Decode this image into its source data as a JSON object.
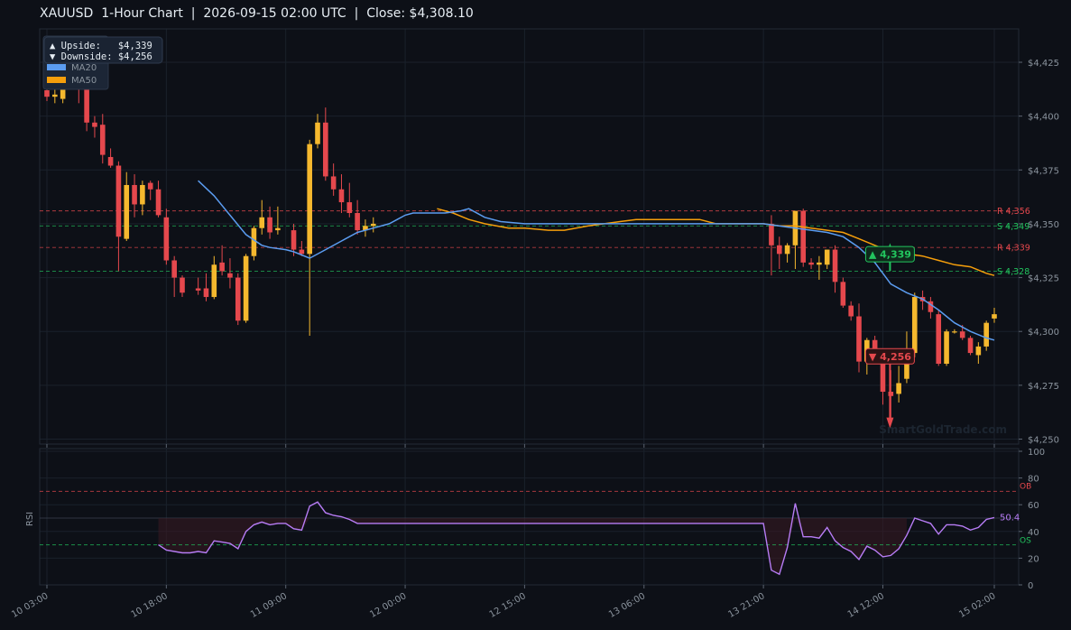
{
  "title": "XAUUSD  1-Hour Chart  |  2026-09-15 02:00 UTC  |  Close: $4,308.10",
  "watermark": "SmartGoldTrade.com",
  "info_box": {
    "upside": "▲ Upside:   $4,339",
    "downside": "▼ Downside: $4,256"
  },
  "colors": {
    "background": "#0d1017",
    "bull": "#f5b82e",
    "bear": "#e5484d",
    "ma20": "#5b9cf0",
    "ma50": "#f59e0b",
    "rsi": "#b77cf5",
    "support": "#22c55e",
    "resistance": "#e5484d"
  },
  "chart_data": [
    {
      "type": "candlestick",
      "title": "XAUUSD  1-Hour Chart  |  2026-09-15 02:00 UTC  |  Close: $4,308.10",
      "ylim": [
        4248,
        4441
      ],
      "y_ticks": [
        "$4,250",
        "$4,275",
        "$4,300",
        "$4,325",
        "$4,350",
        "$4,375",
        "$4,400",
        "$4,425"
      ],
      "y_tick_values": [
        4250,
        4275,
        4300,
        4325,
        4350,
        4375,
        4400,
        4425
      ],
      "x_ticks": [
        "10 03:00",
        "10 18:00",
        "11 09:00",
        "12 00:00",
        "12 15:00",
        "13 06:00",
        "13 21:00",
        "14 12:00",
        "15 02:00"
      ],
      "x_tick_index": [
        0,
        15,
        30,
        45,
        60,
        75,
        90,
        105,
        119
      ],
      "legend": [
        "MA20",
        "MA50"
      ],
      "legend_position": "top-left",
      "grid": true,
      "candles": [
        {
          "i": 0,
          "o": 4412,
          "h": 4418,
          "l": 4407,
          "c": 4409
        },
        {
          "i": 1,
          "o": 4409,
          "h": 4414,
          "l": 4406,
          "c": 4410
        },
        {
          "i": 2,
          "o": 4408,
          "h": 4416,
          "l": 4406,
          "c": 4414
        },
        {
          "i": 4,
          "o": 4425,
          "h": 4432,
          "l": 4406,
          "c": 4418
        },
        {
          "i": 5,
          "o": 4417,
          "h": 4418,
          "l": 4393,
          "c": 4397
        },
        {
          "i": 6,
          "o": 4397,
          "h": 4400,
          "l": 4390,
          "c": 4395
        },
        {
          "i": 7,
          "o": 4396,
          "h": 4401,
          "l": 4378,
          "c": 4382
        },
        {
          "i": 8,
          "o": 4381,
          "h": 4385,
          "l": 4376,
          "c": 4377
        },
        {
          "i": 9,
          "o": 4377,
          "h": 4379,
          "l": 4328,
          "c": 4344
        },
        {
          "i": 10,
          "o": 4343,
          "h": 4374,
          "l": 4342,
          "c": 4368
        },
        {
          "i": 11,
          "o": 4368,
          "h": 4373,
          "l": 4353,
          "c": 4359
        },
        {
          "i": 12,
          "o": 4359,
          "h": 4370,
          "l": 4354,
          "c": 4368
        },
        {
          "i": 13,
          "o": 4369,
          "h": 4370,
          "l": 4361,
          "c": 4366
        },
        {
          "i": 14,
          "o": 4366,
          "h": 4370,
          "l": 4353,
          "c": 4354
        },
        {
          "i": 15,
          "o": 4353,
          "h": 4357,
          "l": 4331,
          "c": 4333
        },
        {
          "i": 16,
          "o": 4333,
          "h": 4335,
          "l": 4316,
          "c": 4325
        },
        {
          "i": 17,
          "o": 4325,
          "h": 4326,
          "l": 4316,
          "c": 4318
        },
        {
          "i": 19,
          "o": 4320,
          "h": 4325,
          "l": 4317,
          "c": 4319
        },
        {
          "i": 20,
          "o": 4320,
          "h": 4327,
          "l": 4314,
          "c": 4316
        },
        {
          "i": 21,
          "o": 4316,
          "h": 4335,
          "l": 4315,
          "c": 4331
        },
        {
          "i": 22,
          "o": 4332,
          "h": 4340,
          "l": 4326,
          "c": 4328
        },
        {
          "i": 23,
          "o": 4327,
          "h": 4334,
          "l": 4320,
          "c": 4325
        },
        {
          "i": 24,
          "o": 4325,
          "h": 4327,
          "l": 4303,
          "c": 4305
        },
        {
          "i": 25,
          "o": 4305,
          "h": 4336,
          "l": 4304,
          "c": 4335
        },
        {
          "i": 26,
          "o": 4335,
          "h": 4349,
          "l": 4333,
          "c": 4348
        },
        {
          "i": 27,
          "o": 4348,
          "h": 4361,
          "l": 4345,
          "c": 4353
        },
        {
          "i": 28,
          "o": 4353,
          "h": 4358,
          "l": 4343,
          "c": 4346
        },
        {
          "i": 29,
          "o": 4347,
          "h": 4358,
          "l": 4345,
          "c": 4348
        },
        {
          "i": 31,
          "o": 4347,
          "h": 4350,
          "l": 4335,
          "c": 4338
        },
        {
          "i": 32,
          "o": 4338,
          "h": 4342,
          "l": 4335,
          "c": 4336
        },
        {
          "i": 33,
          "o": 4336,
          "h": 4389,
          "l": 4298,
          "c": 4387
        },
        {
          "i": 34,
          "o": 4387,
          "h": 4401,
          "l": 4385,
          "c": 4397
        },
        {
          "i": 35,
          "o": 4397,
          "h": 4404,
          "l": 4370,
          "c": 4372
        },
        {
          "i": 36,
          "o": 4372,
          "h": 4378,
          "l": 4363,
          "c": 4366
        },
        {
          "i": 37,
          "o": 4366,
          "h": 4373,
          "l": 4355,
          "c": 4360
        },
        {
          "i": 38,
          "o": 4360,
          "h": 4369,
          "l": 4353,
          "c": 4355
        },
        {
          "i": 39,
          "o": 4355,
          "h": 4361,
          "l": 4345,
          "c": 4347
        },
        {
          "i": 40,
          "o": 4347,
          "h": 4352,
          "l": 4344,
          "c": 4349
        },
        {
          "i": 41,
          "o": 4349,
          "h": 4353,
          "l": 4346,
          "c": 4350
        },
        {
          "i": 91,
          "o": 4350,
          "h": 4354,
          "l": 4326,
          "c": 4340
        },
        {
          "i": 92,
          "o": 4340,
          "h": 4344,
          "l": 4329,
          "c": 4336
        },
        {
          "i": 93,
          "o": 4336,
          "h": 4341,
          "l": 4332,
          "c": 4340
        },
        {
          "i": 94,
          "o": 4340,
          "h": 4356,
          "l": 4329,
          "c": 4356
        },
        {
          "i": 95,
          "o": 4356,
          "h": 4357,
          "l": 4330,
          "c": 4332
        },
        {
          "i": 96,
          "o": 4332,
          "h": 4334,
          "l": 4329,
          "c": 4331
        },
        {
          "i": 97,
          "o": 4331,
          "h": 4335,
          "l": 4324,
          "c": 4332
        },
        {
          "i": 98,
          "o": 4331,
          "h": 4338,
          "l": 4329,
          "c": 4338
        },
        {
          "i": 99,
          "o": 4338,
          "h": 4340,
          "l": 4318,
          "c": 4323
        },
        {
          "i": 100,
          "o": 4323,
          "h": 4325,
          "l": 4311,
          "c": 4312
        },
        {
          "i": 101,
          "o": 4312,
          "h": 4314,
          "l": 4305,
          "c": 4307
        },
        {
          "i": 102,
          "o": 4307,
          "h": 4313,
          "l": 4281,
          "c": 4286
        },
        {
          "i": 103,
          "o": 4286,
          "h": 4297,
          "l": 4280,
          "c": 4296
        },
        {
          "i": 104,
          "o": 4296,
          "h": 4298,
          "l": 4285,
          "c": 4287
        },
        {
          "i": 105,
          "o": 4288,
          "h": 4292,
          "l": 4266,
          "c": 4272
        },
        {
          "i": 106,
          "o": 4272,
          "h": 4282,
          "l": 4259,
          "c": 4270
        },
        {
          "i": 107,
          "o": 4271,
          "h": 4284,
          "l": 4267,
          "c": 4276
        },
        {
          "i": 108,
          "o": 4278,
          "h": 4300,
          "l": 4276,
          "c": 4290
        },
        {
          "i": 109,
          "o": 4290,
          "h": 4318,
          "l": 4288,
          "c": 4316
        },
        {
          "i": 110,
          "o": 4316,
          "h": 4319,
          "l": 4310,
          "c": 4314
        },
        {
          "i": 111,
          "o": 4314,
          "h": 4316,
          "l": 4306,
          "c": 4309
        },
        {
          "i": 112,
          "o": 4308,
          "h": 4310,
          "l": 4284,
          "c": 4285
        },
        {
          "i": 113,
          "o": 4285,
          "h": 4301,
          "l": 4284,
          "c": 4300
        },
        {
          "i": 114,
          "o": 4300,
          "h": 4301,
          "l": 4299,
          "c": 4300
        },
        {
          "i": 115,
          "o": 4300,
          "h": 4303,
          "l": 4296,
          "c": 4297
        },
        {
          "i": 116,
          "o": 4297,
          "h": 4298,
          "l": 4289,
          "c": 4290
        },
        {
          "i": 117,
          "o": 4289,
          "h": 4295,
          "l": 4285,
          "c": 4293
        },
        {
          "i": 118,
          "o": 4293,
          "h": 4305,
          "l": 4291,
          "c": 4304
        },
        {
          "i": 119,
          "o": 4306,
          "h": 4311,
          "l": 4304,
          "c": 4308
        }
      ],
      "ma20": [
        [
          19,
          4370
        ],
        [
          21,
          4363
        ],
        [
          23,
          4354
        ],
        [
          25,
          4345
        ],
        [
          27,
          4340
        ],
        [
          28,
          4339
        ],
        [
          30,
          4338
        ],
        [
          31,
          4337
        ],
        [
          33,
          4334
        ],
        [
          35,
          4338
        ],
        [
          37,
          4342
        ],
        [
          39,
          4346
        ],
        [
          41,
          4348
        ],
        [
          43,
          4350
        ],
        [
          44,
          4352
        ],
        [
          45,
          4354
        ],
        [
          46,
          4355
        ],
        [
          48,
          4355
        ],
        [
          50,
          4355
        ],
        [
          52,
          4356
        ],
        [
          53,
          4357
        ],
        [
          55,
          4353
        ],
        [
          57,
          4351
        ],
        [
          60,
          4350
        ],
        [
          70,
          4350
        ],
        [
          80,
          4350
        ],
        [
          90,
          4350
        ],
        [
          94,
          4348
        ],
        [
          96,
          4347
        ],
        [
          98,
          4346
        ],
        [
          100,
          4344
        ],
        [
          102,
          4339
        ],
        [
          104,
          4332
        ],
        [
          105,
          4327
        ],
        [
          106,
          4322
        ],
        [
          108,
          4318
        ],
        [
          110,
          4315
        ],
        [
          112,
          4310
        ],
        [
          114,
          4304
        ],
        [
          116,
          4300
        ],
        [
          118,
          4297
        ],
        [
          119,
          4296
        ]
      ],
      "ma50": [
        [
          49,
          4357
        ],
        [
          51,
          4355
        ],
        [
          53,
          4352
        ],
        [
          55,
          4350
        ],
        [
          58,
          4348
        ],
        [
          60,
          4348
        ],
        [
          63,
          4347
        ],
        [
          65,
          4347
        ],
        [
          68,
          4349
        ],
        [
          70,
          4350
        ],
        [
          72,
          4351
        ],
        [
          74,
          4352
        ],
        [
          76,
          4352
        ],
        [
          78,
          4352
        ],
        [
          80,
          4352
        ],
        [
          82,
          4352
        ],
        [
          84,
          4350
        ],
        [
          86,
          4350
        ],
        [
          88,
          4350
        ],
        [
          90,
          4350
        ],
        [
          92,
          4349
        ],
        [
          94,
          4349
        ],
        [
          96,
          4348
        ],
        [
          98,
          4347
        ],
        [
          100,
          4346
        ],
        [
          102,
          4343
        ],
        [
          104,
          4340
        ],
        [
          106,
          4337
        ],
        [
          108,
          4336
        ],
        [
          110,
          4335
        ],
        [
          112,
          4333
        ],
        [
          114,
          4331
        ],
        [
          116,
          4330
        ],
        [
          118,
          4327
        ],
        [
          119,
          4326
        ]
      ],
      "levels": [
        {
          "label": "R 4,356",
          "value": 4356,
          "kind": "resistance"
        },
        {
          "label": "S 4,349",
          "value": 4349,
          "kind": "support"
        },
        {
          "label": "R 4,339",
          "value": 4339,
          "kind": "resistance"
        },
        {
          "label": "S 4,328",
          "value": 4328,
          "kind": "support"
        }
      ],
      "annotations": [
        {
          "label": "▲ 4,339",
          "value": 4339,
          "kind": "upside"
        },
        {
          "label": "▼ 4,256",
          "value": 4256,
          "kind": "downside"
        }
      ]
    },
    {
      "type": "line",
      "ylabel": "RSI",
      "ylim": [
        0,
        100
      ],
      "y_ticks": [
        "0",
        "20",
        "40",
        "60",
        "80",
        "100"
      ],
      "y_tick_values": [
        0,
        20,
        40,
        60,
        80,
        100
      ],
      "overbought": {
        "label": "OB",
        "value": 70
      },
      "oversold": {
        "label": "OS",
        "value": 30
      },
      "last_value_label": "50.4",
      "rsi": [
        [
          14,
          30
        ],
        [
          15,
          26
        ],
        [
          17,
          24
        ],
        [
          18,
          24
        ],
        [
          19,
          25
        ],
        [
          20,
          24
        ],
        [
          21,
          33
        ],
        [
          22,
          32
        ],
        [
          23,
          31
        ],
        [
          24,
          27
        ],
        [
          25,
          40
        ],
        [
          26,
          45
        ],
        [
          27,
          47
        ],
        [
          28,
          45
        ],
        [
          29,
          46
        ],
        [
          30,
          46
        ],
        [
          31,
          42
        ],
        [
          32,
          41
        ],
        [
          33,
          59
        ],
        [
          34,
          62
        ],
        [
          35,
          54
        ],
        [
          36,
          52
        ],
        [
          37,
          51
        ],
        [
          38,
          49
        ],
        [
          39,
          46
        ],
        [
          40,
          46
        ],
        [
          45,
          46
        ],
        [
          50,
          46
        ],
        [
          60,
          46
        ],
        [
          70,
          46
        ],
        [
          80,
          46
        ],
        [
          90,
          46
        ],
        [
          91,
          11
        ],
        [
          92,
          8
        ],
        [
          93,
          28
        ],
        [
          94,
          61
        ],
        [
          95,
          36
        ],
        [
          96,
          36
        ],
        [
          97,
          35
        ],
        [
          98,
          43
        ],
        [
          99,
          33
        ],
        [
          100,
          28
        ],
        [
          101,
          25
        ],
        [
          102,
          19
        ],
        [
          103,
          29
        ],
        [
          104,
          26
        ],
        [
          105,
          21
        ],
        [
          106,
          22
        ],
        [
          107,
          27
        ],
        [
          108,
          37
        ],
        [
          109,
          50
        ],
        [
          110,
          48
        ],
        [
          111,
          46
        ],
        [
          112,
          38
        ],
        [
          113,
          45
        ],
        [
          114,
          45
        ],
        [
          115,
          44
        ],
        [
          116,
          41
        ],
        [
          117,
          43
        ],
        [
          118,
          49
        ],
        [
          119,
          50.4
        ]
      ]
    }
  ]
}
